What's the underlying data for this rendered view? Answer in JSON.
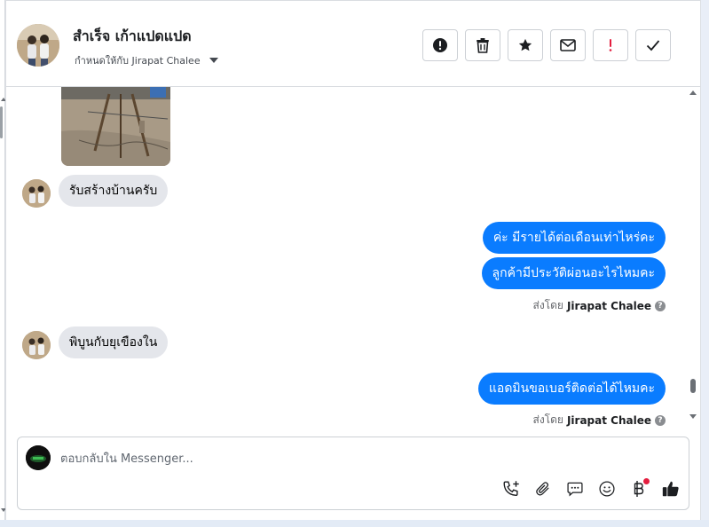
{
  "contact": {
    "name": "สำเร็จ เก้าแปดแปด",
    "assigned_label": "กำหนดให้กับ Jirapat Chalee"
  },
  "actions": [
    {
      "name": "report-spam",
      "icon": "exclamation-circle-icon"
    },
    {
      "name": "delete",
      "icon": "trash-icon"
    },
    {
      "name": "star",
      "icon": "star-icon"
    },
    {
      "name": "mark-unread",
      "icon": "envelope-icon"
    },
    {
      "name": "follow-up",
      "icon": "red-exclamation-icon"
    },
    {
      "name": "mark-done",
      "icon": "checkmark-icon"
    }
  ],
  "messages": [
    {
      "direction": "in",
      "text": "รับสร้างบ้านครับ"
    },
    {
      "direction": "out",
      "text": "ค่ะ มีรายได้ต่อเดือนเท่าไหร่คะ"
    },
    {
      "direction": "out",
      "text": "ลูกค้ามีประวัติผ่อนอะไรไหมคะ"
    },
    {
      "direction": "in",
      "text": "พิบูนกับยุเขืองใน"
    },
    {
      "direction": "out",
      "text": "แอดมินขอเบอร์ติดต่อได้ไหมคะ"
    }
  ],
  "sent_by": {
    "prefix": "ส่งโดย",
    "agent": "Jirapat Chalee",
    "help": "?"
  },
  "composer": {
    "placeholder": "ตอบกลับใน Messenger...",
    "value": ""
  },
  "colors": {
    "accent": "#0a7cff",
    "incoming_bubble": "#e4e6eb",
    "notify_dot": "#e41e3f"
  }
}
